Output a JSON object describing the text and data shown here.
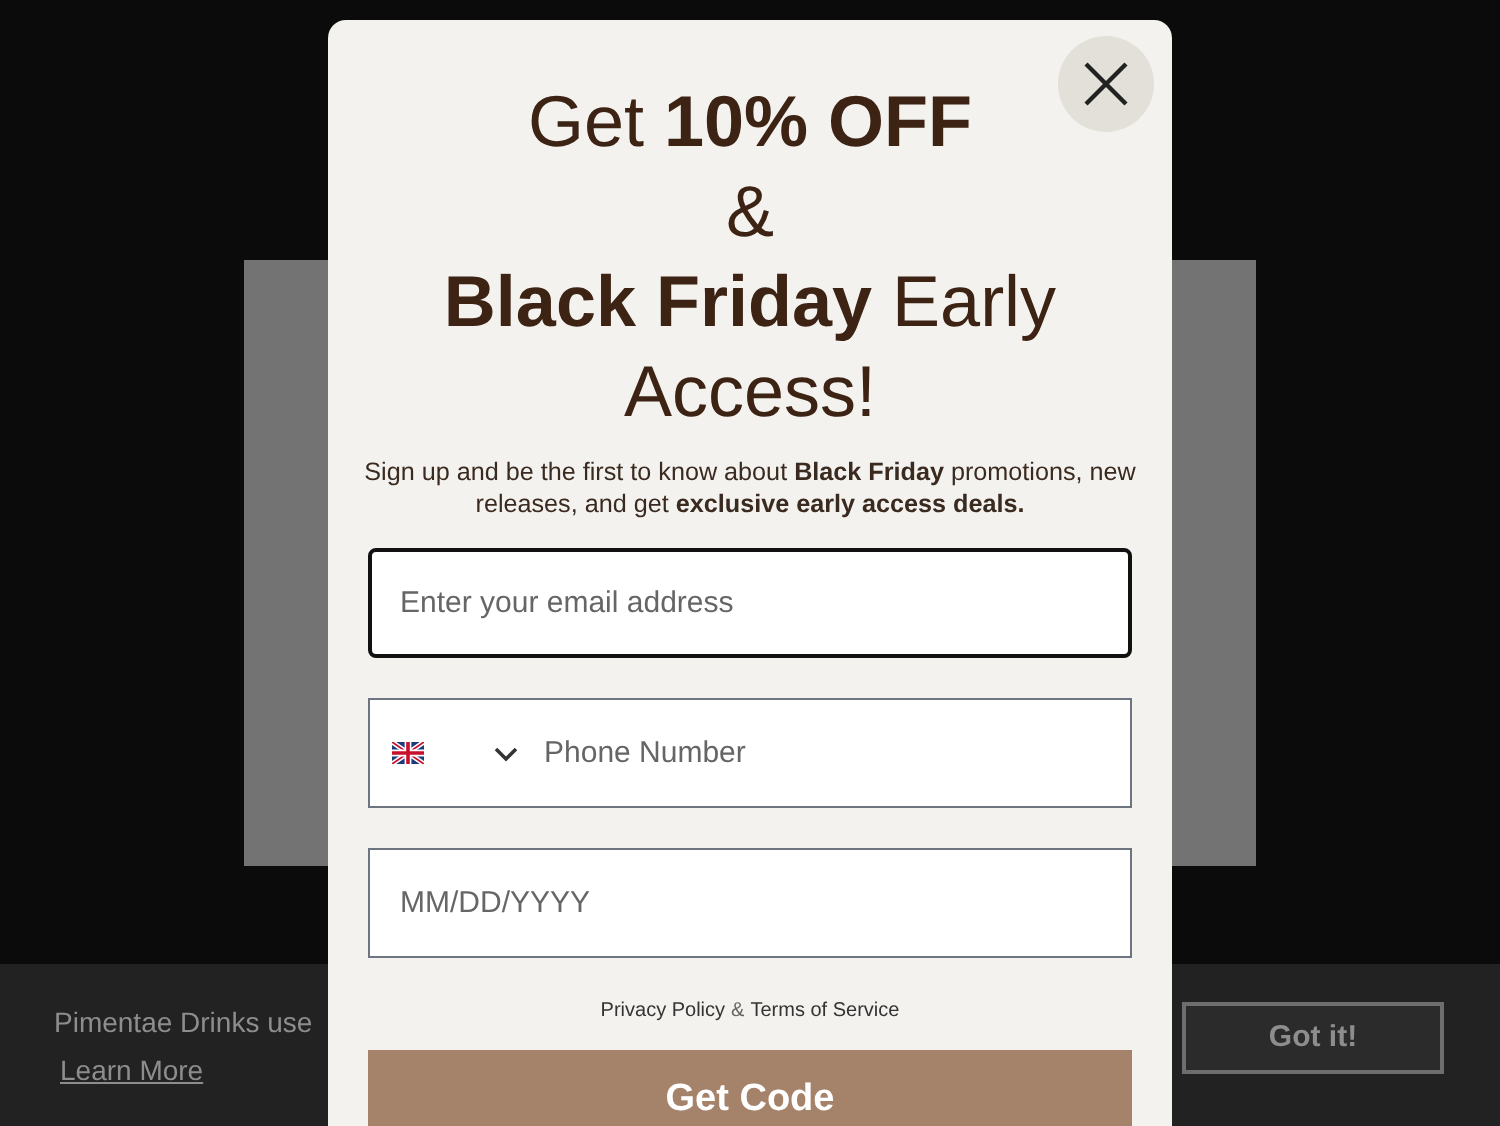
{
  "popup": {
    "headline": [
      "Get **10% OFF**",
      "&",
      "**Black Friday** Early",
      "Access!"
    ],
    "description": "Sign up and be the first to know about **Black Friday** promotions, new releases, and get **exclusive early access deals.**",
    "email_field": {
      "placeholder": "Enter your email address",
      "focused": true
    },
    "phone_field": {
      "placeholder": "Phone Number"
    },
    "date_field": {
      "placeholder": "MM/DD/YYYY"
    },
    "legal_links": [
      "Privacy Policy",
      "Terms of Service"
    ],
    "legal_separator": "&",
    "submit_button": "Get Code"
  },
  "cookie_bar": {
    "message": "Pimentae Drinks use",
    "link": "Learn More",
    "button": "Got it!"
  }
}
